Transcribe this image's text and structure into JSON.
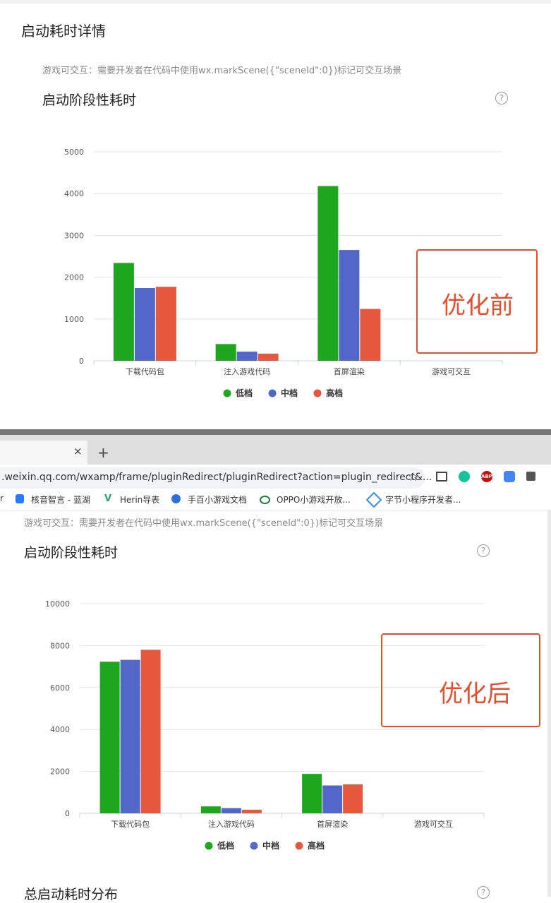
{
  "top": {
    "panel_title": "启动耗时详情",
    "hint": "游戏可交互：需要开发者在代码中使用wx.markScene({\"sceneId\":0})标记可交互场景",
    "section_title": "启动阶段性耗时",
    "help_glyph": "?",
    "annotation": "优化前"
  },
  "browser": {
    "tab_close": "×",
    "new_tab": "+",
    "url": ".weixin.qq.com/wxamp/frame/pluginRedirect/pluginRedirect?action=plugin_redirect&...",
    "star_icon": "☆",
    "bookmarks": [
      {
        "label": "r"
      },
      {
        "label": "核音智言 - 蓝湖"
      },
      {
        "label": "Herin导表"
      },
      {
        "label": "手百小游戏文档"
      },
      {
        "label": "OPPO小游戏开放..."
      },
      {
        "label": "字节小程序开发者..."
      }
    ],
    "extension_icons": [
      "screenshot-icon",
      "grammarly-icon",
      "adblock-icon",
      "translate-icon",
      "puzzle-icon"
    ],
    "adblock_text": "ABP"
  },
  "bottom": {
    "hint": "游戏可交互：需要开发者在代码中使用wx.markScene({\"sceneId\":0})标记可交互场景",
    "section_title": "启动阶段性耗时",
    "help_glyph": "?",
    "annotation": "优化后",
    "next_section_title": "总启动耗时分布"
  },
  "colors": {
    "low": "#1fa61f",
    "mid": "#5367c9",
    "high": "#e5583e",
    "annotation": "#e4502d"
  },
  "chart_data": [
    {
      "type": "bar",
      "categories": [
        "下载代码包",
        "注入游戏代码",
        "首屏渲染",
        "游戏可交互"
      ],
      "series": [
        {
          "name": "低档",
          "values": [
            2340,
            400,
            4180,
            0
          ]
        },
        {
          "name": "中档",
          "values": [
            1740,
            220,
            2650,
            0
          ]
        },
        {
          "name": "高档",
          "values": [
            1770,
            170,
            1240,
            0
          ]
        }
      ],
      "ylim": [
        0,
        5000
      ],
      "yticks": [
        "0",
        "1000",
        "2000",
        "3000",
        "4000",
        "5000"
      ],
      "legend": "bottom",
      "grid": true
    },
    {
      "type": "bar",
      "categories": [
        "下载代码包",
        "注入游戏代码",
        "首屏渲染",
        "游戏可交互"
      ],
      "series": [
        {
          "name": "低档",
          "values": [
            7230,
            330,
            1880,
            0
          ]
        },
        {
          "name": "中档",
          "values": [
            7320,
            250,
            1330,
            0
          ]
        },
        {
          "name": "高档",
          "values": [
            7800,
            170,
            1380,
            0
          ]
        }
      ],
      "ylim": [
        0,
        10000
      ],
      "yticks": [
        "0",
        "2000",
        "4000",
        "6000",
        "8000",
        "10000"
      ],
      "legend": "bottom",
      "grid": true
    }
  ]
}
